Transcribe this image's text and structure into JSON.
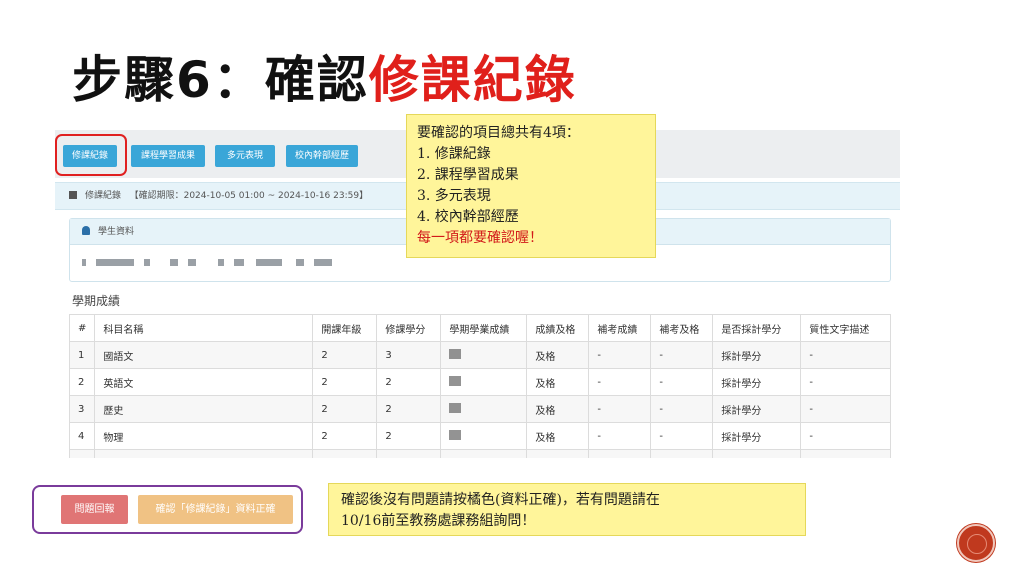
{
  "title": {
    "part1": "步驟6：確認",
    "part2": "修課紀錄"
  },
  "tabs": [
    {
      "label": "修課紀錄"
    },
    {
      "label": "課程學習成果"
    },
    {
      "label": "多元表現"
    },
    {
      "label": "校內幹部經歷"
    }
  ],
  "info_strip": {
    "label": "修課紀錄",
    "period": "【確認期限：2024-10-05 01:00 ~ 2024-10-16 23:59】"
  },
  "student_panel": {
    "title": "學生資料"
  },
  "grades": {
    "section_title": "學期成績",
    "headers": [
      "#",
      "科目名稱",
      "開課年級",
      "修課學分",
      "學期學業成績",
      "成績及格",
      "補考成績",
      "補考及格",
      "是否採計學分",
      "質性文字描述"
    ],
    "rows": [
      [
        "1",
        "國語文",
        "2",
        "3",
        "",
        "及格",
        "-",
        "-",
        "採計學分",
        "-"
      ],
      [
        "2",
        "英語文",
        "2",
        "2",
        "",
        "及格",
        "-",
        "-",
        "採計學分",
        "-"
      ],
      [
        "3",
        "歷史",
        "2",
        "2",
        "",
        "及格",
        "-",
        "-",
        "採計學分",
        "-"
      ],
      [
        "4",
        "物理",
        "2",
        "2",
        "",
        "及格",
        "-",
        "-",
        "採計學分",
        "-"
      ]
    ]
  },
  "callout_items": {
    "heading": "要確認的項目總共有4項：",
    "items": [
      "1.  修課紀錄",
      "2.  課程學習成果",
      "3.  多元表現",
      "4.  校內幹部經歷"
    ],
    "note": "每一項都要確認喔！"
  },
  "bottom_buttons": {
    "report": "問題回報",
    "confirm": "確認「修課紀錄」資料正確"
  },
  "callout_instructions": {
    "line1": "確認後沒有問題請按橘色(資料正確)，若有問題請在",
    "line2": "10/16前至教務處課務組詢問！"
  },
  "colors": {
    "accent_red": "#e0201b",
    "tab_blue": "#3aa6d8",
    "report_btn": "#e07575",
    "confirm_btn": "#f0c284",
    "highlight_yellow": "#fff59a"
  }
}
